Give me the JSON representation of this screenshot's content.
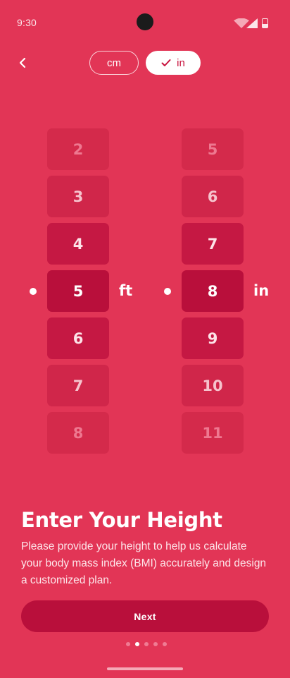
{
  "status_bar": {
    "time": "9:30"
  },
  "unit_toggle": {
    "cm_label": "cm",
    "in_label": "in",
    "selected": "in"
  },
  "feet_picker": {
    "values": [
      "2",
      "3",
      "4",
      "5",
      "6",
      "7",
      "8"
    ],
    "selected": "5",
    "unit": "ft"
  },
  "inches_picker": {
    "values": [
      "5",
      "6",
      "7",
      "8",
      "9",
      "10",
      "11"
    ],
    "selected": "8",
    "unit": "in"
  },
  "content": {
    "title": "Enter Your Height",
    "description": "Please provide your height to help us calculate your body mass index (BMI) accurately and design a customized plan."
  },
  "next_button": {
    "label": "Next"
  },
  "pager": {
    "count": 5,
    "active_index": 1
  },
  "colors": {
    "background": "#E23556",
    "accent_dark": "#B90F3B",
    "white": "#FFFFFF"
  },
  "icons": [
    "back-arrow-icon",
    "check-icon",
    "wifi-icon",
    "signal-icon",
    "battery-icon"
  ]
}
